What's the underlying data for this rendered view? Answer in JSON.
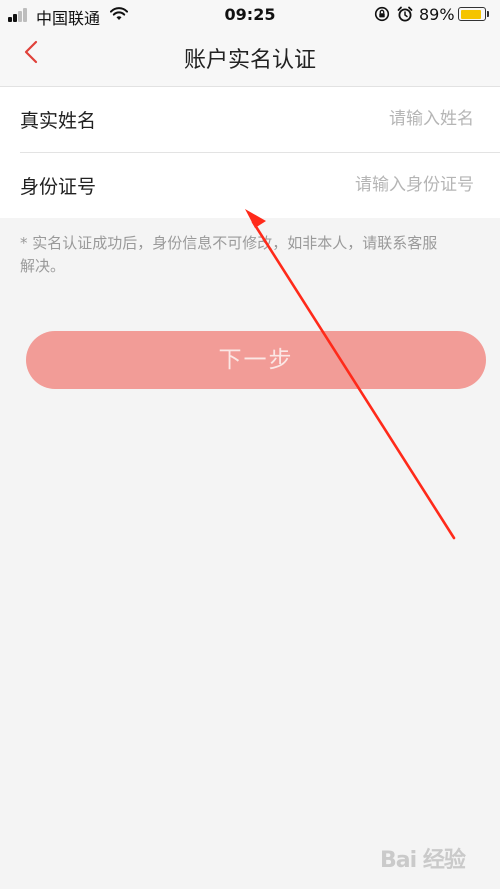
{
  "status_bar": {
    "carrier": "中国联通",
    "time": "09:25",
    "battery_percent": "89%",
    "battery_level": 0.89,
    "battery_color": "#f5c400"
  },
  "nav": {
    "back_icon": "chevron-left-icon",
    "title": "账户实名认证"
  },
  "form": {
    "name": {
      "label": "真实姓名",
      "placeholder": "请输入姓名",
      "value": ""
    },
    "id_number": {
      "label": "身份证号",
      "placeholder": "请输入身份证号",
      "value": ""
    }
  },
  "notice": "* 实名认证成功后，身份信息不可修改，如非本人，请联系客服解决。",
  "next_button": {
    "label": "下一步",
    "color": "#f29c97"
  },
  "watermark": {
    "text": "Bai 经验"
  },
  "colors": {
    "accent": "#e0413a",
    "annotation_arrow": "#ff2a1a",
    "background": "#f4f4f4"
  }
}
